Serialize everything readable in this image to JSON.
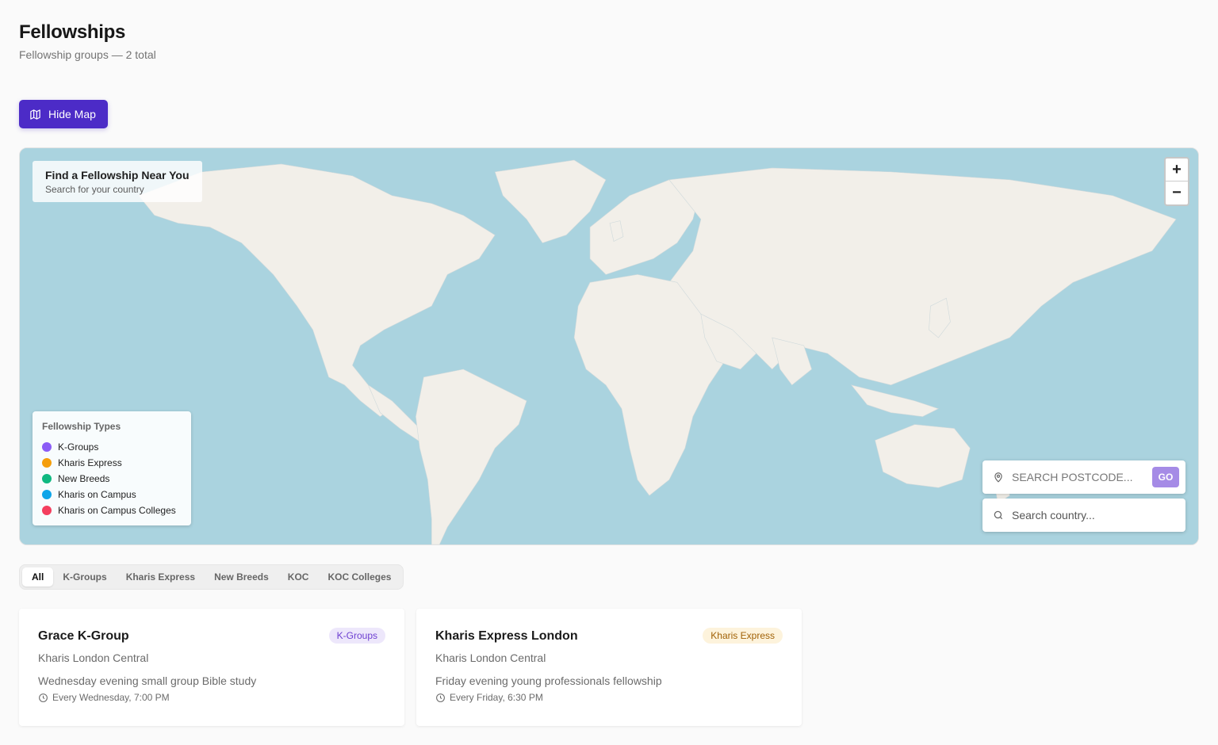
{
  "header": {
    "title": "Fellowships",
    "subtitle": "Fellowship groups — 2 total"
  },
  "toolbar": {
    "hide_map_label": "Hide Map",
    "hide_map_icon": "map-icon"
  },
  "map": {
    "find_title": "Find a Fellowship Near You",
    "find_subtitle": "Search for your country",
    "zoom_in": "+",
    "zoom_out": "−",
    "legend": {
      "title": "Fellowship Types",
      "items": [
        {
          "label": "K-Groups",
          "color": "#8b5cf6"
        },
        {
          "label": "Kharis Express",
          "color": "#f59e0b"
        },
        {
          "label": "New Breeds",
          "color": "#10b981"
        },
        {
          "label": "Kharis on Campus",
          "color": "#0ea5e9"
        },
        {
          "label": "Kharis on Campus Colleges",
          "color": "#f43f5e"
        }
      ]
    },
    "postcode_placeholder": "SEARCH POSTCODE...",
    "go_label": "GO",
    "country_placeholder": "Search country...",
    "colors": {
      "water": "#aad3df",
      "land": "#f2efe9"
    }
  },
  "filters": {
    "tabs": [
      "All",
      "K-Groups",
      "Kharis Express",
      "New Breeds",
      "KOC",
      "KOC Colleges"
    ],
    "active": "All"
  },
  "cards": [
    {
      "title": "Grace K-Group",
      "badge": "K-Groups",
      "badge_bg": "#ede7fb",
      "badge_color": "#6d3fd1",
      "location": "Kharis London Central",
      "description": "Wednesday evening small group Bible study",
      "schedule": "Every Wednesday, 7:00 PM"
    },
    {
      "title": "Kharis Express London",
      "badge": "Kharis Express",
      "badge_bg": "#fdf3dc",
      "badge_color": "#a16207",
      "location": "Kharis London Central",
      "description": "Friday evening young professionals fellowship",
      "schedule": "Every Friday, 6:30 PM"
    }
  ]
}
